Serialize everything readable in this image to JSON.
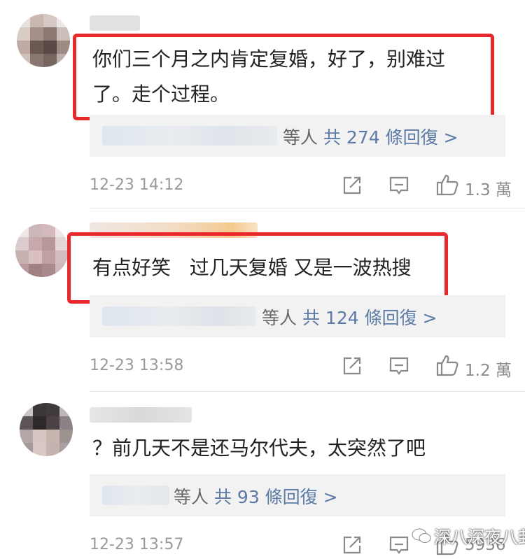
{
  "comments": [
    {
      "text_line1": "你们三个月之内肯定复婚，好了，别难过",
      "text_line2": "了。走个过程。",
      "reply_suffix": "等人",
      "reply_link": "共 274 條回復 >",
      "time": "12-23 14:12",
      "likes": "1.3 萬"
    },
    {
      "text_line1": "有点好笑   过几天复婚 又是一波热搜",
      "reply_suffix": "等人",
      "reply_link": "共 124 條回復 >",
      "time": "12-23 13:58",
      "likes": "1.2 萬"
    },
    {
      "text_line1": "？前几天不是还马尔代夫，太突然了吧",
      "reply_suffix": "等人",
      "reply_link": "共 93 條回復 >",
      "time": "12-23 13:57",
      "likes": "5936"
    }
  ],
  "watermark": "深八深夜八卦",
  "colors": {
    "highlight_border": "#e8282b",
    "link": "#5b7aa6",
    "reply_bg": "#f2f2f2"
  },
  "icons": [
    "share-icon",
    "comment-icon",
    "thumbs-up-icon"
  ]
}
